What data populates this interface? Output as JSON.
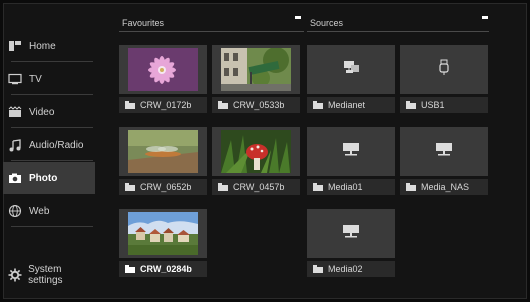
{
  "sidebar": {
    "items": [
      {
        "label": "Home",
        "icon": "home-icon"
      },
      {
        "label": "TV",
        "icon": "tv-icon"
      },
      {
        "label": "Video",
        "icon": "video-icon"
      },
      {
        "label": "Audio/Radio",
        "icon": "music-note-icon"
      },
      {
        "label": "Photo",
        "icon": "camera-icon",
        "active": true
      },
      {
        "label": "Web",
        "icon": "globe-icon"
      }
    ],
    "settings_label": "System settings"
  },
  "favourites": {
    "title": "Favourites",
    "items": [
      {
        "name": "CRW_0172b",
        "thumb": "pink-flower"
      },
      {
        "name": "CRW_0533b",
        "thumb": "street-sign"
      },
      {
        "name": "CRW_0652b",
        "thumb": "dragonfly"
      },
      {
        "name": "CRW_0457b",
        "thumb": "mushroom"
      },
      {
        "name": "CRW_0284b",
        "thumb": "village",
        "selected": true
      }
    ]
  },
  "sources": {
    "title": "Sources",
    "items": [
      {
        "name": "Medianet",
        "icon": "network-icon"
      },
      {
        "name": "USB1",
        "icon": "usb-icon"
      },
      {
        "name": "Media01",
        "icon": "server-icon"
      },
      {
        "name": "Media_NAS",
        "icon": "server-icon"
      },
      {
        "name": "Media02",
        "icon": "server-icon"
      }
    ]
  },
  "colors": {
    "background": "#141414",
    "tile": "#3a3a3a",
    "caption": "#2a2a2a",
    "active_nav": "#3a3a3a"
  }
}
